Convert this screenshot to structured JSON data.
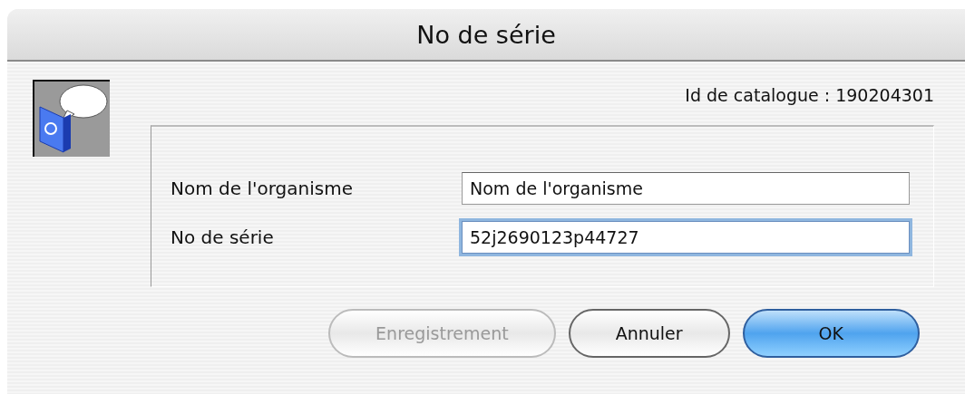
{
  "window": {
    "title": "No de série"
  },
  "catalogue_id": "Id de catalogue : 190204301",
  "fields": [
    {
      "label": "Nom de l'organisme",
      "value": "Nom de l'organisme",
      "focused": false
    },
    {
      "label": "No de série",
      "value": "52j2690123p44727",
      "focused": true
    }
  ],
  "buttons": [
    {
      "label": "Enregistrement",
      "disabled": true,
      "default": false
    },
    {
      "label": "Annuler",
      "disabled": false,
      "default": false
    },
    {
      "label": "OK",
      "disabled": false,
      "default": true
    }
  ]
}
